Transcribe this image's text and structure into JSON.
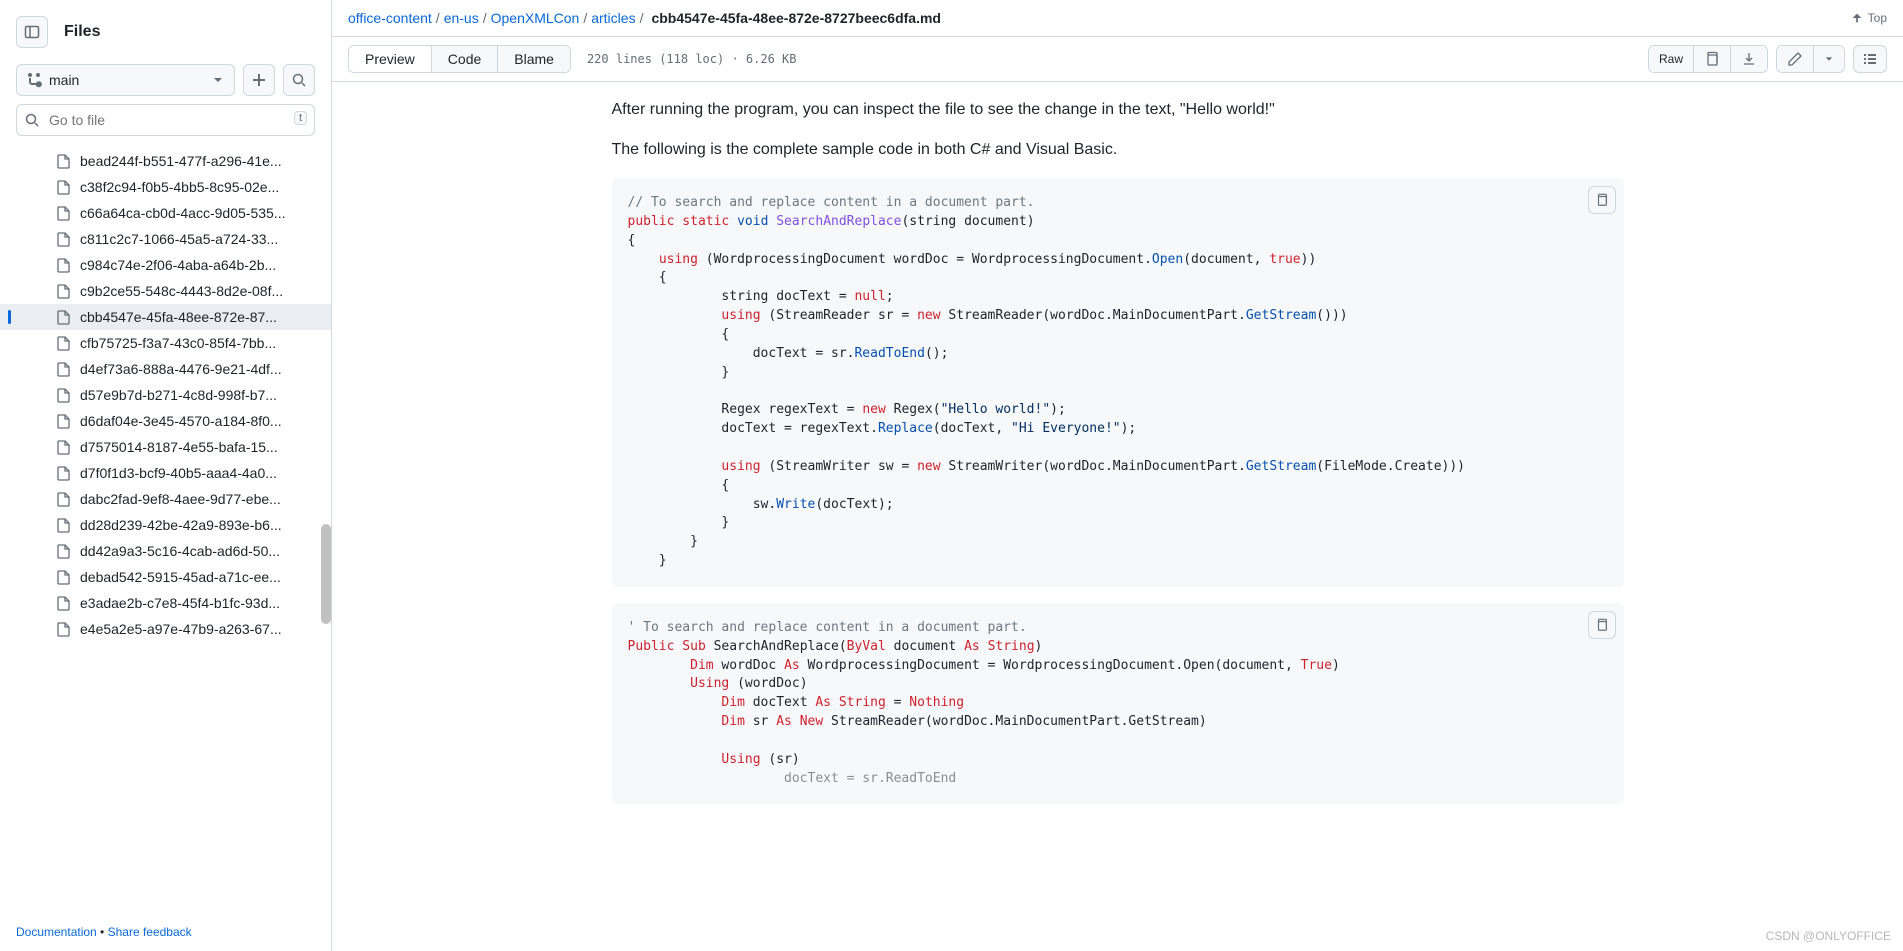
{
  "sidebar": {
    "title": "Files",
    "branch": "main",
    "search_placeholder": "Go to file",
    "kbd": "t",
    "files": [
      "bead244f-b551-477f-a296-41e...",
      "c38f2c94-f0b5-4bb5-8c95-02e...",
      "c66a64ca-cb0d-4acc-9d05-535...",
      "c811c2c7-1066-45a5-a724-33...",
      "c984c74e-2f06-4aba-a64b-2b...",
      "c9b2ce55-548c-4443-8d2e-08f...",
      "cbb4547e-45fa-48ee-872e-87...",
      "cfb75725-f3a7-43c0-85f4-7bb...",
      "d4ef73a6-888a-4476-9e21-4df...",
      "d57e9b7d-b271-4c8d-998f-b7...",
      "d6daf04e-3e45-4570-a184-8f0...",
      "d7575014-8187-4e55-bafa-15...",
      "d7f0f1d3-bcf9-40b5-aaa4-4a0...",
      "dabc2fad-9ef8-4aee-9d77-ebe...",
      "dd28d239-42be-42a9-893e-b6...",
      "dd42a9a3-5c16-4cab-ad6d-50...",
      "debad542-5915-45ad-a71c-ee...",
      "e3adae2b-c7e8-45f4-b1fc-93d...",
      "e4e5a2e5-a97e-47b9-a263-67..."
    ],
    "active_index": 6,
    "footer": {
      "doc": "Documentation",
      "sep": " • ",
      "feedback": "Share feedback"
    }
  },
  "breadcrumb": {
    "parts": [
      "office-content",
      "en-us",
      "OpenXMLCon",
      "articles"
    ],
    "current": "cbb4547e-45fa-48ee-872e-8727beec6dfa.md",
    "top": "Top"
  },
  "tabs": {
    "preview": "Preview",
    "code": "Code",
    "blame": "Blame"
  },
  "stats": "220 lines (118 loc) · 6.26 KB",
  "raw": "Raw",
  "article": {
    "p1": "After running the program, you can inspect the file to see the change in the text, \"Hello world!\"",
    "p2": "The following is the complete sample code in both C# and Visual Basic."
  },
  "code1": {
    "comment": "// To search and replace content in a document part.",
    "public": "public",
    "static": "static",
    "void": "void",
    "fn": "SearchAndReplace",
    "sig_tail": "(string document)",
    "using": "using",
    "new": "new",
    "null": "null",
    "true": "true",
    "l1a": " (WordprocessingDocument wordDoc = WordprocessingDocument.",
    "open": "Open",
    "l1b": "(document, ",
    "l1c": "))",
    "l2a": "            string docText = ",
    "l3a": " (StreamReader sr = ",
    "l3b": " StreamReader(wordDoc.MainDocumentPart.",
    "getstream": "GetStream",
    "l3c": "()))",
    "l4a": "                docText = sr.",
    "readtoend": "ReadToEnd",
    "l4b": "();",
    "l5a": "            Regex regexText = ",
    "l5b": " Regex(",
    "str1": "\"Hello world!\"",
    "l5c": ");",
    "l6a": "            docText = regexText.",
    "replace": "Replace",
    "l6b": "(docText, ",
    "str2": "\"Hi Everyone!\"",
    "l6c": ");",
    "l7a": " (StreamWriter sw = ",
    "l7b": " StreamWriter(wordDoc.MainDocumentPart.",
    "l7c": "(FileMode.Create)))",
    "l8a": "                sw.",
    "write": "Write",
    "l8b": "(docText);"
  },
  "code2": {
    "comment": "' To search and replace content in a document part.",
    "public": "Public",
    "sub": "Sub",
    "fn": "SearchAndReplace",
    "byval": "ByVal",
    "as": "As",
    "string": "String",
    "dim": "Dim",
    "true": "True",
    "new": "New",
    "nothing": "Nothing",
    "using": "Using",
    "sig_a": "(",
    "sig_b": " document ",
    "sig_c": ")",
    "l1a": " wordDoc ",
    "l1b": " WordprocessingDocument = WordprocessingDocument.Open(document, ",
    "l1c": ")",
    "l2a": " (wordDoc)",
    "l3a": " docText ",
    "l3b": " = ",
    "l4a": " sr ",
    "l4b": " StreamReader(wordDoc.MainDocumentPart.GetStream)",
    "l5a": " (sr)",
    "l6a": "                    docText = sr.ReadToEnd"
  },
  "watermark": "CSDN @ONLYOFFICE"
}
